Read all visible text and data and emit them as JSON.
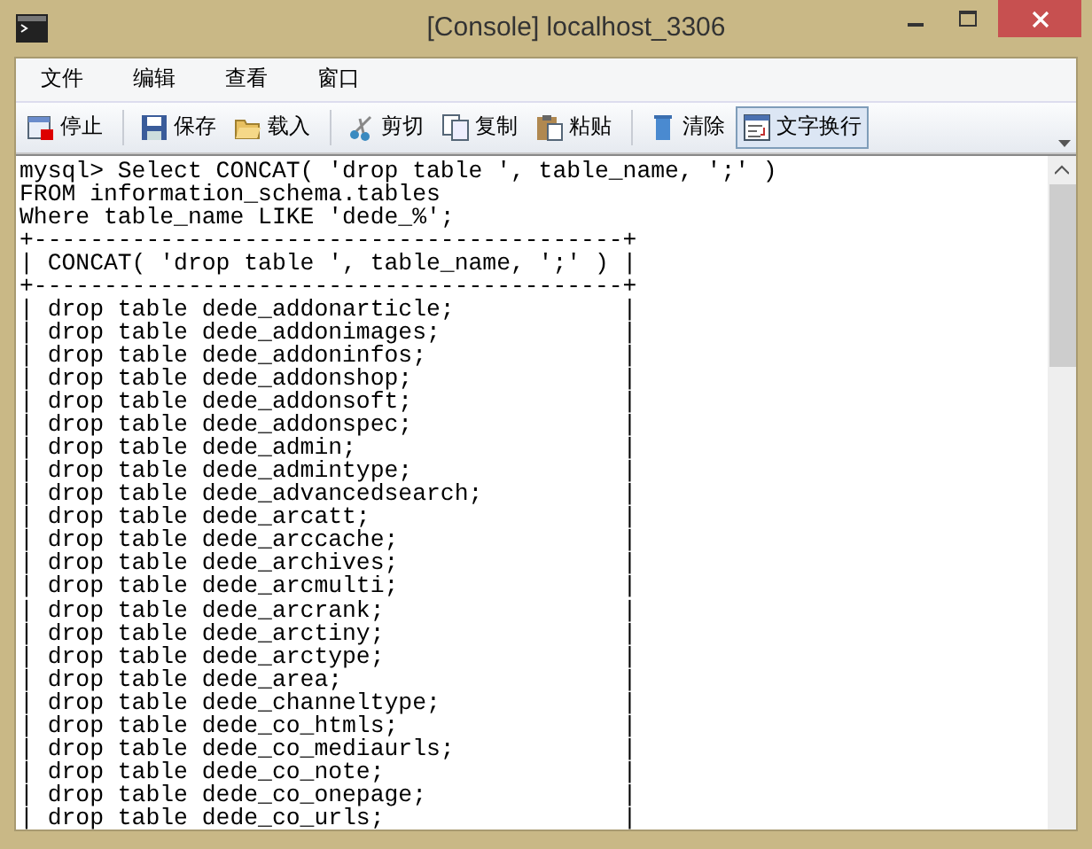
{
  "window": {
    "title": "[Console] localhost_3306"
  },
  "menu": [
    "文件",
    "编辑",
    "查看",
    "窗口"
  ],
  "toolbar": [
    {
      "items": [
        {
          "label": "停止",
          "selected": false
        }
      ]
    },
    {
      "items": [
        {
          "label": "保存",
          "selected": false
        },
        {
          "label": "载入",
          "selected": false
        }
      ]
    },
    {
      "items": [
        {
          "label": "剪切",
          "selected": false
        },
        {
          "label": "复制",
          "selected": false
        },
        {
          "label": "粘贴",
          "selected": false
        }
      ]
    },
    {
      "items": [
        {
          "label": "清除",
          "selected": false
        },
        {
          "label": "文字换行",
          "selected": true
        }
      ]
    }
  ],
  "console": {
    "lines": [
      "mysql> Select CONCAT( 'drop table ', table_name, ';' )",
      "FROM information_schema.tables",
      "Where table_name LIKE 'dede_%';",
      "+------------------------------------------+",
      "| CONCAT( 'drop table ', table_name, ';' ) |",
      "+------------------------------------------+",
      "| drop table dede_addonarticle;            |",
      "| drop table dede_addonimages;             |",
      "| drop table dede_addoninfos;              |",
      "| drop table dede_addonshop;               |",
      "| drop table dede_addonsoft;               |",
      "| drop table dede_addonspec;               |",
      "| drop table dede_admin;                   |",
      "| drop table dede_admintype;               |",
      "| drop table dede_advancedsearch;          |",
      "| drop table dede_arcatt;                  |",
      "| drop table dede_arccache;                |",
      "| drop table dede_archives;                |",
      "| drop table dede_arcmulti;                |",
      "| drop table dede_arcrank;                 |",
      "| drop table dede_arctiny;                 |",
      "| drop table dede_arctype;                 |",
      "| drop table dede_area;                    |",
      "| drop table dede_channeltype;             |",
      "| drop table dede_co_htmls;                |",
      "| drop table dede_co_mediaurls;            |",
      "| drop table dede_co_note;                 |",
      "| drop table dede_co_onepage;              |",
      "| drop table dede_co_urls;                 |"
    ]
  }
}
